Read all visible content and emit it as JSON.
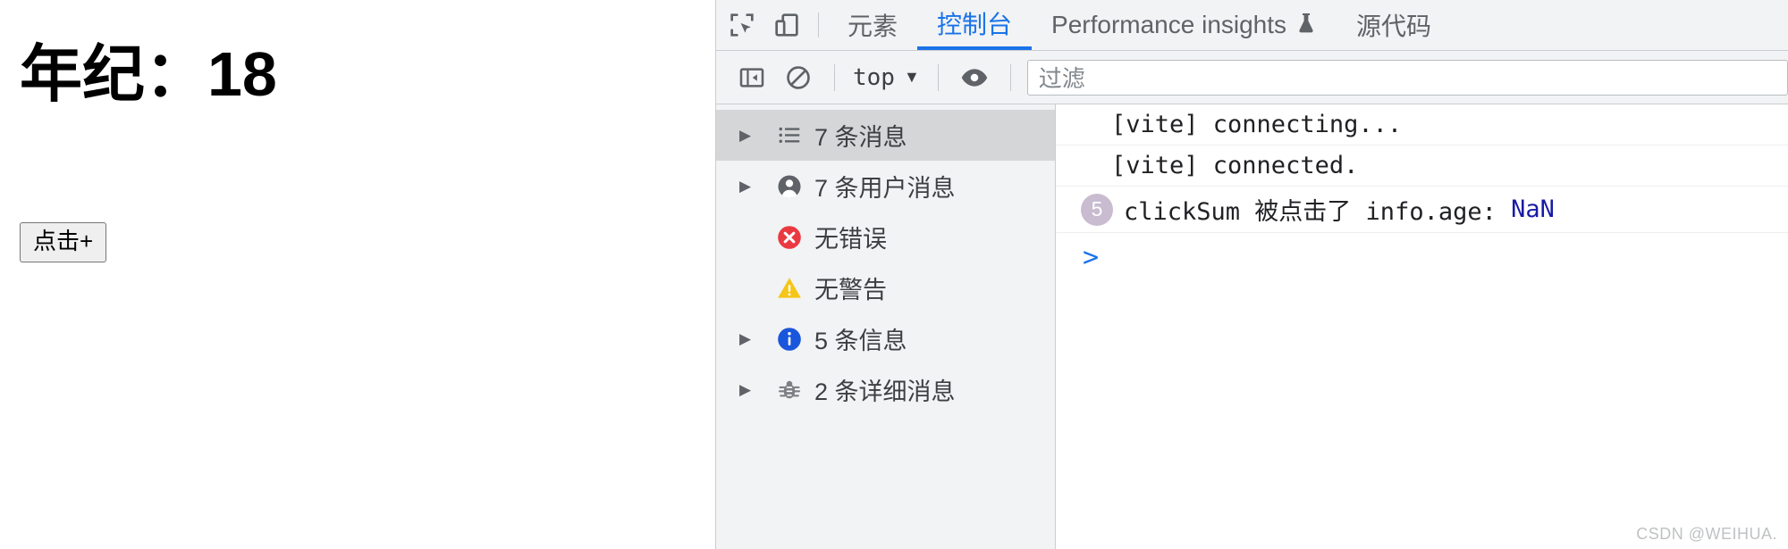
{
  "page": {
    "heading": "年纪：18",
    "button_label": "点击+"
  },
  "devtools": {
    "toolbar_icons": [
      {
        "name": "inspect-element-icon",
        "title": "检查元素"
      },
      {
        "name": "device-toolbar-icon",
        "title": "切换设备工具栏"
      }
    ],
    "tabs": [
      {
        "label": "元素",
        "active": false
      },
      {
        "label": "控制台",
        "active": true
      },
      {
        "label": "Performance insights",
        "active": false,
        "badge": "flask-icon"
      },
      {
        "label": "源代码",
        "active": false
      }
    ],
    "console_toolbar": {
      "sidebar_toggle_icon": "show-console-sidebar-icon",
      "clear_icon": "clear-console-icon",
      "context_label": "top",
      "context_caret": "▼",
      "eye_icon": "live-expression-icon",
      "filter_placeholder": "过滤",
      "filter_value": ""
    },
    "sidebar": {
      "items": [
        {
          "label": "7 条消息",
          "icon": "list-icon",
          "arrow": true,
          "selected": true
        },
        {
          "label": "7 条用户消息",
          "icon": "user-icon",
          "arrow": true,
          "selected": false
        },
        {
          "label": "无错误",
          "icon": "error-icon",
          "arrow": false,
          "selected": false
        },
        {
          "label": "无警告",
          "icon": "warning-icon",
          "arrow": false,
          "selected": false
        },
        {
          "label": "5 条信息",
          "icon": "info-icon",
          "arrow": true,
          "selected": false
        },
        {
          "label": "2 条详细消息",
          "icon": "verbose-bug-icon",
          "arrow": true,
          "selected": false
        }
      ]
    },
    "messages": [
      {
        "text": "[vite] connecting...",
        "count": "",
        "value": ""
      },
      {
        "text": "[vite] connected.",
        "count": "",
        "value": ""
      },
      {
        "text": "clickSum 被点击了 info.age:",
        "count": "5",
        "value": "NaN"
      }
    ],
    "prompt": ">"
  },
  "watermark": "CSDN @WEIHUA.",
  "colors": {
    "accent": "#1a73e8",
    "error": "#eb3941",
    "warning": "#f5c518",
    "info": "#1a56db",
    "badge": "#c9bbd0",
    "value": "#1a1aa6",
    "panel_bg": "#f1f3f4",
    "selected_row": "#d5d6d7"
  }
}
